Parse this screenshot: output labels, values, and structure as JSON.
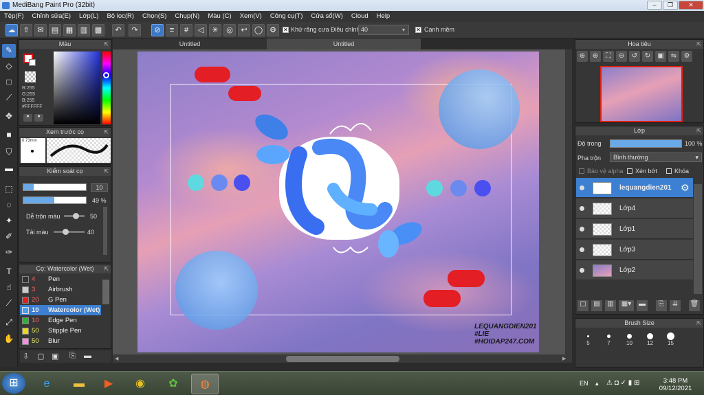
{
  "window": {
    "title": "MediBang Paint Pro (32bit)",
    "min": "–",
    "restore": "❐",
    "close": "✕"
  },
  "menu": [
    "Tệp(F)",
    "Chỉnh sửa(E)",
    "Lớp(L)",
    "Bộ lọc(R)",
    "Chọn(S)",
    "Chụp(N)",
    "Màu (C)",
    "Xem(V)",
    "Công cụ(T)",
    "Cửa sổ(W)",
    "Cloud",
    "Help"
  ],
  "toolbar": {
    "antialias_label": "Khử răng cưa",
    "adjust_label": "Điều chỉnh",
    "adjust_value": "40",
    "sharp_label": "Cạnh mềm"
  },
  "color_panel": {
    "title": "Màu",
    "rgb_r": "R:255",
    "rgb_g": "G:255",
    "rgb_b": "B:255",
    "hex": "#FFFFFF"
  },
  "brush_preview": {
    "title": "Xem trước cọ",
    "size": "0.73mm"
  },
  "brush_control": {
    "title": "Kiểm soát cọ",
    "size": "10",
    "opacity": "49 %",
    "blend_label": "Dễ trộn màu",
    "blend_value": "50",
    "reload_label": "Tải màu",
    "reload_value": "40"
  },
  "brush_list": {
    "title": "Cọ: Watercolor (Wet)",
    "items": [
      {
        "size": "4",
        "name": "Pen",
        "color": "#333333"
      },
      {
        "size": "3",
        "name": "Airbrush",
        "color": "#cccccc"
      },
      {
        "size": "20",
        "name": "G Pen",
        "color": "#e02020"
      },
      {
        "size": "10",
        "name": "Watercolor (Wet)",
        "color": "#4a9ff0"
      },
      {
        "size": "10",
        "name": "Edge Pen",
        "color": "#30b030"
      },
      {
        "size": "50",
        "name": "Stipple Pen",
        "color": "#e8d820"
      },
      {
        "size": "50",
        "name": "Blur",
        "color": "#f090e0"
      }
    ]
  },
  "tabs": [
    "Untitled",
    "Untitled"
  ],
  "canvas": {
    "watermark_line1": "LEQUANGDIEN201",
    "watermark_line2": "#LIE",
    "watermark_line3": "#HOIDAP247.COM"
  },
  "navigator": {
    "title": "Hoa tiêu"
  },
  "layers": {
    "title": "Lớp",
    "opacity_label": "Độ trong",
    "opacity_value": "100 %",
    "blend_label": "Pha trộn",
    "blend_value": "Bình thường",
    "protect_alpha": "Bảo vệ alpha",
    "clip": "Xén bớt",
    "lock": "Khóa",
    "items": [
      "lequangdien201",
      "Lớp4",
      "Lớp1",
      "Lớp3",
      "Lớp2"
    ]
  },
  "brush_size": {
    "title": "Brush Size",
    "sizes": [
      "5",
      "7",
      "10",
      "12",
      "15"
    ]
  },
  "taskbar": {
    "lang": "EN",
    "time": "3:48 PM",
    "date": "09/12/2021"
  }
}
